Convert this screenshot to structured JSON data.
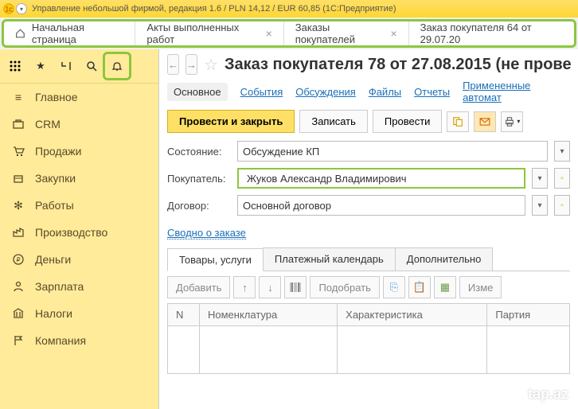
{
  "app": {
    "title": "Управление небольшой фирмой, редакция 1.6 / PLN 14,12 / EUR 60,85  (1С:Предприятие)"
  },
  "tabs": [
    {
      "label": "Начальная страница",
      "closable": false,
      "home": true
    },
    {
      "label": "Акты выполненных работ",
      "closable": true
    },
    {
      "label": "Заказы покупателей",
      "closable": true
    },
    {
      "label": "Заказ покупателя 64 от 29.07.20",
      "closable": false
    }
  ],
  "sidebar": {
    "items": [
      {
        "label": "Главное",
        "icon": "menu"
      },
      {
        "label": "CRM",
        "icon": "briefcase"
      },
      {
        "label": "Продажи",
        "icon": "cart"
      },
      {
        "label": "Закупки",
        "icon": "box"
      },
      {
        "label": "Работы",
        "icon": "wrench"
      },
      {
        "label": "Производство",
        "icon": "factory"
      },
      {
        "label": "Деньги",
        "icon": "ruble"
      },
      {
        "label": "Зарплата",
        "icon": "person"
      },
      {
        "label": "Налоги",
        "icon": "bank"
      },
      {
        "label": "Компания",
        "icon": "flag"
      }
    ]
  },
  "page": {
    "title": "Заказ покупателя 78 от 27.08.2015 (не прове",
    "subtabs": [
      "Основное",
      "События",
      "Обсуждения",
      "Файлы",
      "Отчеты",
      "Примененные автомат"
    ],
    "actions": {
      "primary": "Провести и закрыть",
      "save": "Записать",
      "post": "Провести"
    },
    "fields": {
      "state_label": "Состояние:",
      "state_value": "Обсуждение КП",
      "customer_label": "Покупатель:",
      "customer_value": "Жуков Александр Владимирович",
      "contract_label": "Договор:",
      "contract_value": "Основной договор"
    },
    "summary_link": "Сводно о заказе",
    "inner_tabs": [
      "Товары, услуги",
      "Платежный календарь",
      "Дополнительно"
    ],
    "table_actions": {
      "add": "Добавить",
      "select": "Подобрать",
      "edit": "Изме"
    },
    "columns": [
      "N",
      "Номенклатура",
      "Характеристика",
      "Партия"
    ]
  },
  "watermark": "tap.az"
}
